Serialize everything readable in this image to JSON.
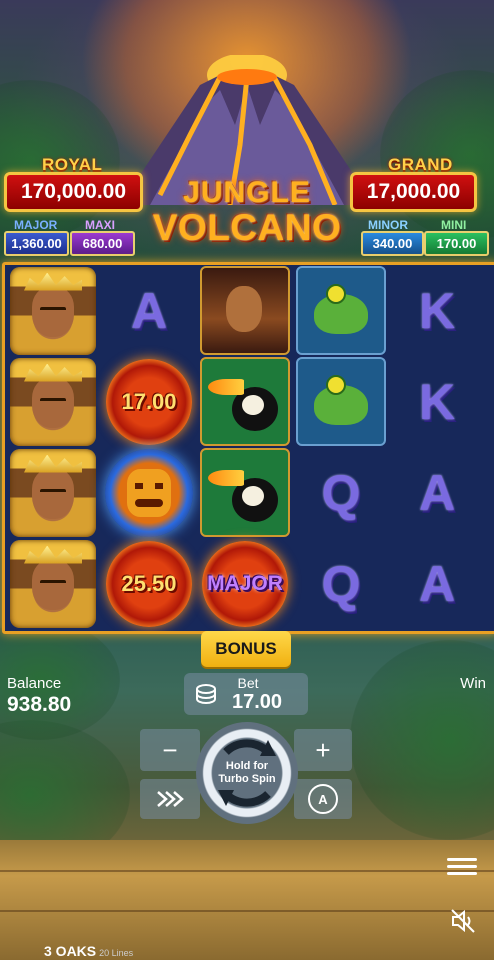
{
  "game": {
    "logo_line1": "JUNGLE",
    "logo_line2": "VOLCANO"
  },
  "jackpots": {
    "royal": {
      "label": "ROYAL",
      "value": "170,000.00"
    },
    "grand": {
      "label": "GRAND",
      "value": "17,000.00"
    },
    "major": {
      "label": "MAJOR",
      "value": "1,360.00"
    },
    "maxi": {
      "label": "MAXI",
      "value": "680.00"
    },
    "minor": {
      "label": "MINOR",
      "value": "340.00"
    },
    "mini": {
      "label": "MINI",
      "value": "170.00"
    }
  },
  "reels": [
    [
      "warrior",
      "warrior",
      "warrior",
      "warrior"
    ],
    [
      "A",
      "coin:17.00",
      "idol",
      "coin:25.50"
    ],
    [
      "woman",
      "toucan",
      "toucan",
      "coin:MAJOR"
    ],
    [
      "frog",
      "frog",
      "Q",
      "Q"
    ],
    [
      "K",
      "K",
      "A",
      "A"
    ]
  ],
  "symbols_text": {
    "r1c0": "A",
    "coin1": "17.00",
    "coin2": "25.50",
    "coin3": "MAJOR",
    "r3c2": "Q",
    "r3c3": "Q",
    "r4c0": "K",
    "r4c1": "K",
    "r4c2": "A",
    "r4c3": "A"
  },
  "controls": {
    "bonus_label": "BONUS",
    "balance_label": "Balance",
    "balance_value": "938.80",
    "win_label": "Win",
    "bet_label": "Bet",
    "bet_value": "17.00",
    "minus": "−",
    "plus": "+",
    "spin_line1": "Hold for",
    "spin_line2": "Turbo Spin",
    "auto_label": "A"
  },
  "footer": {
    "brand": "3 OAKS",
    "lines": "20 Lines"
  },
  "icons": [
    "coins-icon",
    "spin-arrows-icon",
    "turbo-icon",
    "autoplay-icon",
    "menu-icon",
    "sound-muted-icon"
  ],
  "colors": {
    "accent": "#f0b010",
    "frame": "#e8a024",
    "jackpot_red": "#d01010"
  }
}
